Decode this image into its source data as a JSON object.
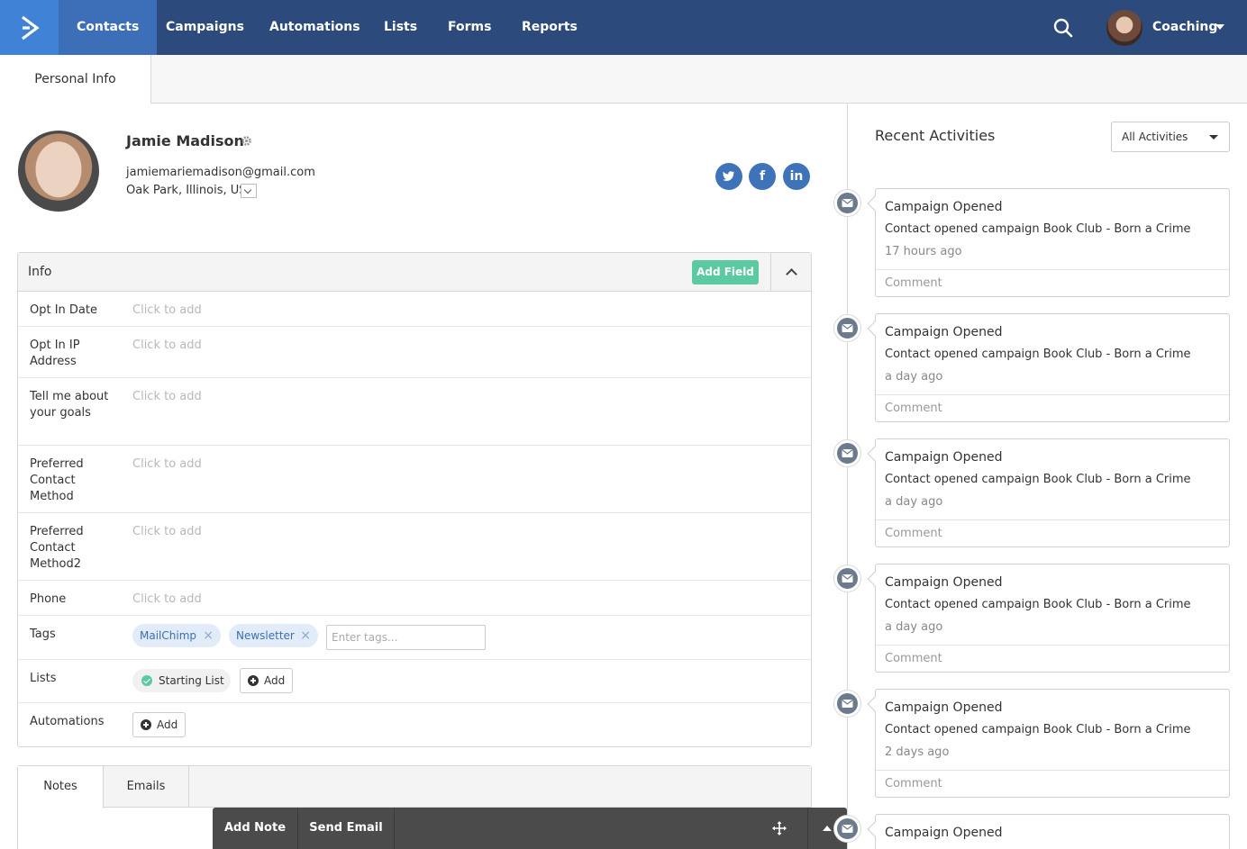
{
  "nav": {
    "items": [
      "Contacts",
      "Campaigns",
      "Automations",
      "Lists",
      "Forms",
      "Reports"
    ],
    "account_name": "Coaching"
  },
  "tabs": {
    "personal_info": "Personal Info"
  },
  "contact": {
    "name": "Jamie Madison",
    "email": "jamiemariemadison@gmail.com",
    "location": "Oak Park, Illinois, US",
    "social": {
      "twitter": "twitter-icon",
      "facebook": "f",
      "linkedin": "in"
    }
  },
  "info": {
    "title": "Info",
    "add_field_label": "Add Field",
    "fields": [
      {
        "label": "Opt In Date",
        "value": "Click to add"
      },
      {
        "label": "Opt In IP Address",
        "value": "Click to add"
      },
      {
        "label": "Tell me about your goals",
        "value": "Click to add"
      },
      {
        "label": "Preferred Contact Method",
        "value": "Click to add"
      },
      {
        "label": "Preferred Contact Method2",
        "value": "Click to add"
      },
      {
        "label": "Phone",
        "value": "Click to add"
      }
    ],
    "tags_label": "Tags",
    "tags": [
      "MailChimp",
      "Newsletter"
    ],
    "tags_placeholder": "Enter tags...",
    "lists_label": "Lists",
    "list_name": "Starting List",
    "add_label": "Add",
    "automations_label": "Automations"
  },
  "notes": {
    "tab_notes": "Notes",
    "tab_emails": "Emails"
  },
  "action_bar": {
    "add_note": "Add Note",
    "send_email": "Send Email"
  },
  "activities": {
    "title": "Recent Activities",
    "filter": "All Activities",
    "items": [
      {
        "title": "Campaign Opened",
        "desc": "Contact opened campaign Book Club - Born a Crime",
        "time": "17 hours ago",
        "comment": "Comment"
      },
      {
        "title": "Campaign Opened",
        "desc": "Contact opened campaign Book Club - Born a Crime",
        "time": "a day ago",
        "comment": "Comment"
      },
      {
        "title": "Campaign Opened",
        "desc": "Contact opened campaign Book Club - Born a Crime",
        "time": "a day ago",
        "comment": "Comment"
      },
      {
        "title": "Campaign Opened",
        "desc": "Contact opened campaign Book Club - Born a Crime",
        "time": "a day ago",
        "comment": "Comment"
      },
      {
        "title": "Campaign Opened",
        "desc": "Contact opened campaign Book Club - Born a Crime",
        "time": "2 days ago",
        "comment": "Comment"
      },
      {
        "title": "Campaign Opened"
      }
    ]
  },
  "colors": {
    "nav_bg": "#2c4b7c",
    "nav_active": "#3c6fb8",
    "accent_green": "#5ccaa1",
    "social_blue": "#3f73b9"
  }
}
